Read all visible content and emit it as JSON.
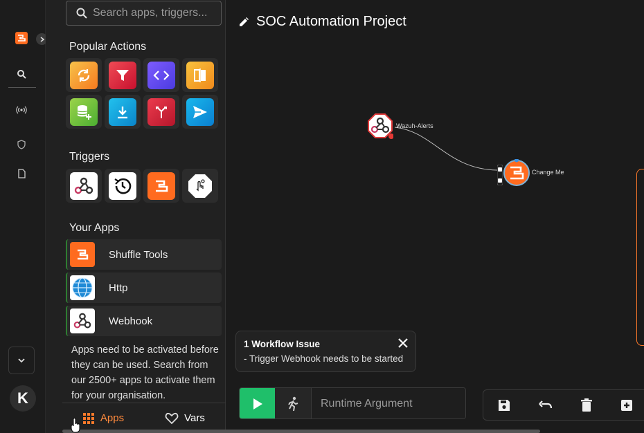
{
  "search": {
    "placeholder": "Search apps, triggers..."
  },
  "sections": {
    "popular": "Popular Actions",
    "triggers": "Triggers",
    "your_apps": "Your Apps"
  },
  "popular_actions": [
    {
      "icon": "refresh-icon",
      "color": "#f59b2b"
    },
    {
      "icon": "filter-icon",
      "color": "#e0323c"
    },
    {
      "icon": "code-icon",
      "color": "#6a4cf2"
    },
    {
      "icon": "compare-icon",
      "color": "#f5a324"
    },
    {
      "icon": "database-add-icon",
      "color": "#7cc83c"
    },
    {
      "icon": "download-icon",
      "color": "#1aa3d9"
    },
    {
      "icon": "merge-icon",
      "color": "#d7263d"
    },
    {
      "icon": "send-icon",
      "color": "#0aa6e0"
    }
  ],
  "triggers": [
    {
      "icon": "webhook-icon",
      "color": "#ffffff"
    },
    {
      "icon": "schedule-icon",
      "color": "#ffffff"
    },
    {
      "icon": "shuffle-logo-icon",
      "color": "#ff6b1f"
    },
    {
      "icon": "user-input-icon",
      "color": "#ffffff"
    }
  ],
  "apps": [
    {
      "name": "Shuffle Tools",
      "icon": "shuffle-tools-icon"
    },
    {
      "name": "Http",
      "icon": "globe-icon"
    },
    {
      "name": "Webhook",
      "icon": "webhook-icon"
    }
  ],
  "help_text": "Apps need to be activated before they can be used. Search from our 2500+ apps to activate them for your organisation.",
  "tabs": {
    "apps": "Apps",
    "vars": "Vars"
  },
  "avatar_letter": "K",
  "workflow": {
    "title": "SOC Automation Project",
    "node_webhook": "Wazuh-Alerts",
    "node_action": "Change Me"
  },
  "issue": {
    "title": "1 Workflow Issue",
    "detail": "- Trigger Webhook needs to be started"
  },
  "runtime": {
    "placeholder": "Runtime Argument"
  },
  "colors": {
    "accent": "#ff6b1f",
    "run": "#1fbf6a"
  }
}
